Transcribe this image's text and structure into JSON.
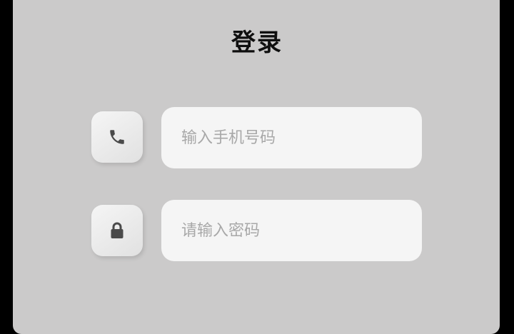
{
  "login": {
    "title": "登录",
    "phone_placeholder": "输入手机号码",
    "password_placeholder": "请输入密码"
  },
  "icons": {
    "phone": "phone-icon",
    "lock": "lock-icon"
  },
  "colors": {
    "background": "#000000",
    "panel": "#cbcaca",
    "field": "#f5f5f5",
    "placeholder": "#a8a8a8",
    "icon": "#4a4a4a"
  }
}
